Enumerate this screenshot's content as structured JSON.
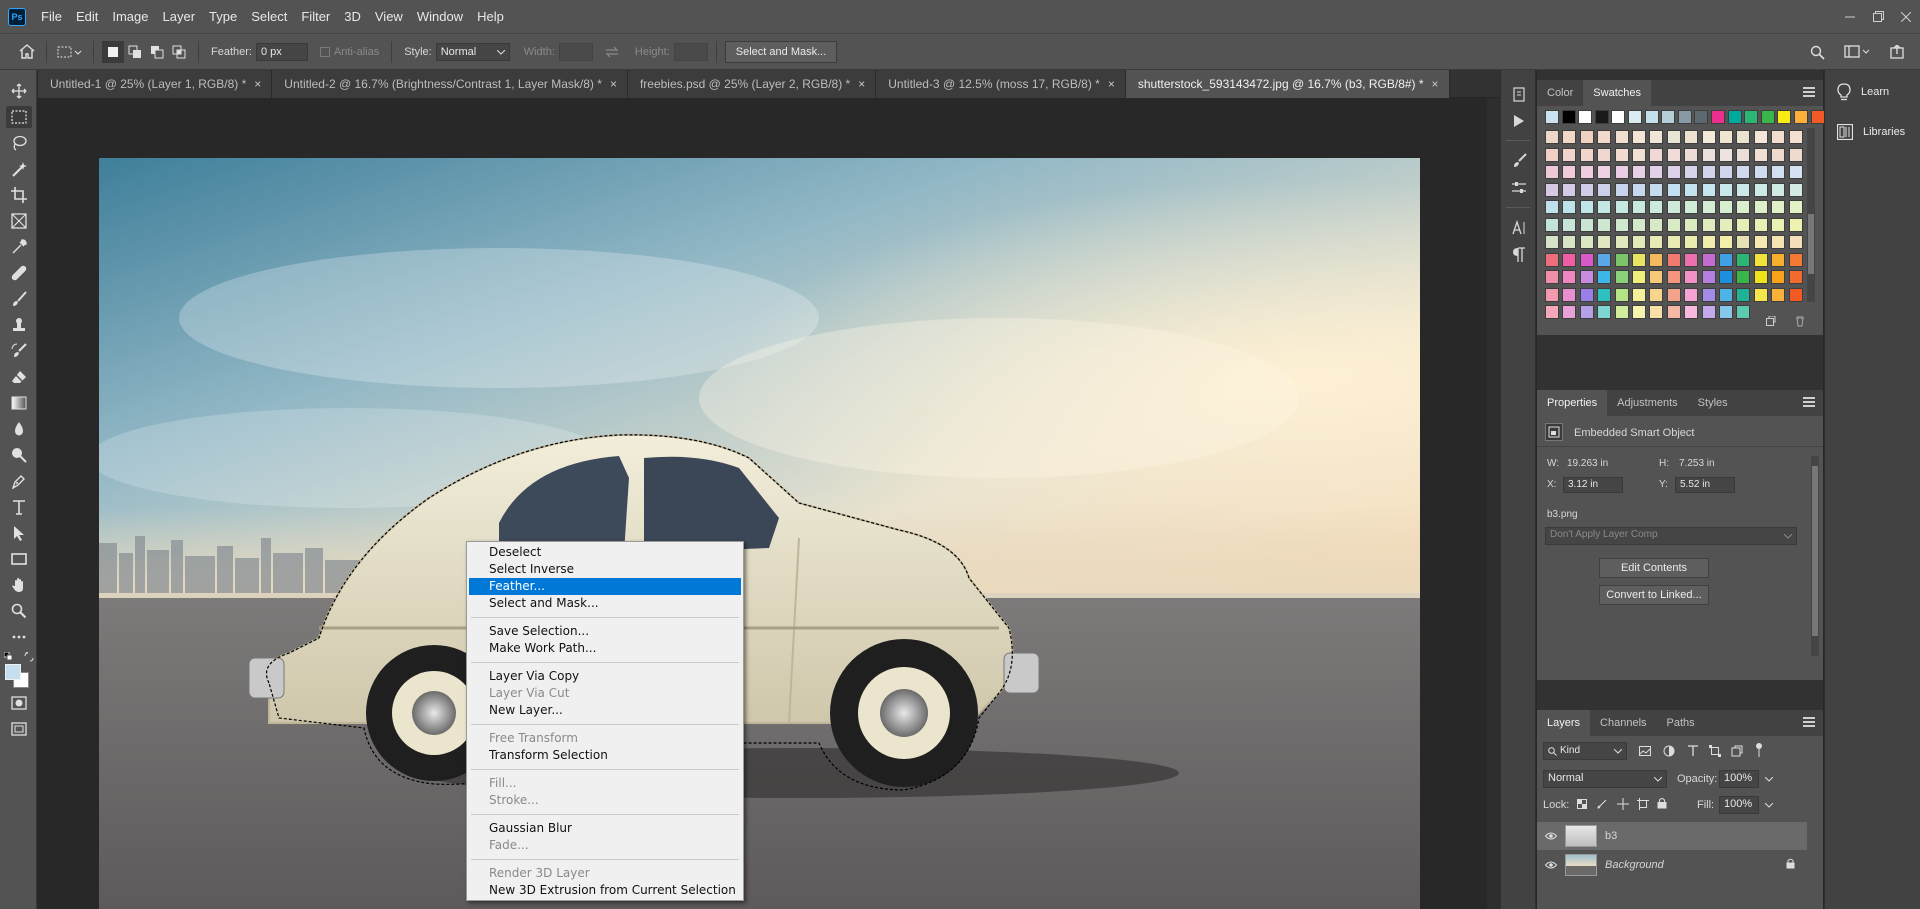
{
  "app": {
    "logo": "Ps"
  },
  "menubar": {
    "items": [
      "File",
      "Edit",
      "Image",
      "Layer",
      "Type",
      "Select",
      "Filter",
      "3D",
      "View",
      "Window",
      "Help"
    ]
  },
  "options": {
    "feather_label": "Feather:",
    "feather_value": "0 px",
    "antialias_label": "Anti-alias",
    "style_label": "Style:",
    "style_value": "Normal",
    "width_label": "Width:",
    "height_label": "Height:",
    "select_mask_label": "Select and Mask..."
  },
  "tabs": [
    {
      "label": "Untitled-1 @ 25% (Layer 1, RGB/8) *",
      "active": false
    },
    {
      "label": "Untitled-2 @ 16.7% (Brightness/Contrast 1, Layer Mask/8) *",
      "active": false
    },
    {
      "label": "freebies.psd @ 25% (Layer 2, RGB/8) *",
      "active": false
    },
    {
      "label": "Untitled-3 @ 12.5% (moss 17, RGB/8) *",
      "active": false
    },
    {
      "label": "shutterstock_593143472.jpg @ 16.7% (b3, RGB/8#) *",
      "active": true
    }
  ],
  "tab_close_glyph": "×",
  "context_menu": {
    "groups": [
      [
        {
          "label": "Deselect",
          "enabled": true
        },
        {
          "label": "Select Inverse",
          "enabled": true
        },
        {
          "label": "Feather...",
          "enabled": true,
          "highlighted": true
        },
        {
          "label": "Select and Mask...",
          "enabled": true
        }
      ],
      [
        {
          "label": "Save Selection...",
          "enabled": true
        },
        {
          "label": "Make Work Path...",
          "enabled": true
        }
      ],
      [
        {
          "label": "Layer Via Copy",
          "enabled": true
        },
        {
          "label": "Layer Via Cut",
          "enabled": false
        },
        {
          "label": "New Layer...",
          "enabled": true
        }
      ],
      [
        {
          "label": "Free Transform",
          "enabled": false
        },
        {
          "label": "Transform Selection",
          "enabled": true
        }
      ],
      [
        {
          "label": "Fill...",
          "enabled": false
        },
        {
          "label": "Stroke...",
          "enabled": false
        }
      ],
      [
        {
          "label": "Gaussian Blur",
          "enabled": true
        },
        {
          "label": "Fade...",
          "enabled": false
        }
      ],
      [
        {
          "label": "Render 3D Layer",
          "enabled": false
        },
        {
          "label": "New 3D Extrusion from Current Selection",
          "enabled": true
        }
      ]
    ]
  },
  "swatches_panel": {
    "tabs": [
      "Color",
      "Swatches"
    ],
    "active_tab": "Swatches",
    "top_row": [
      "#c9e3ef",
      "#000000",
      "#ffffff",
      "#1a1a1a",
      "#ffffff",
      "#d8ecf2",
      "#c5e2ec",
      "#b5cfd9",
      "#8a9aa5",
      "#5c6970",
      "#ec2e8f",
      "#00a99d",
      "#2bb673",
      "#39b54a",
      "#f7ec13",
      "#fbb03b",
      "#f15a24"
    ],
    "grid_rows": [
      [
        "#efd6c8",
        "#f0d8c5",
        "#efd2c1",
        "#f2d9cb",
        "#f0dfcf",
        "#f3e6d6",
        "#f0e6d8",
        "#e9e5d5",
        "#ece2cf",
        "#f3ead8",
        "#f0e7d2",
        "#eae3cf",
        "#f4e6d8",
        "#f1dccf",
        "#f4e0d1"
      ],
      [
        "#f1d0c6",
        "#f1d3ca",
        "#f1d5cd",
        "#f0d7cf",
        "#f2dbd0",
        "#f2e0d5",
        "#efd8d5",
        "#f1dcd8",
        "#eedcd8",
        "#ece1db",
        "#efe3df",
        "#ebddd7",
        "#f0e0d4",
        "#eedbd0",
        "#f0d9ce"
      ],
      [
        "#efc8d8",
        "#f1cadc",
        "#efcce0",
        "#eed2e4",
        "#e9cde4",
        "#e6d0e8",
        "#e3d1ea",
        "#dcd0ea",
        "#d8d2ea",
        "#d2d4ec",
        "#d0d6ee",
        "#cfd8ee",
        "#cfdcef",
        "#d2dff0",
        "#d6e2f2"
      ],
      [
        "#d7c9e3",
        "#d4cbe6",
        "#d0cce8",
        "#cdd0ea",
        "#c9d4ec",
        "#c6d8ee",
        "#c5dcef",
        "#c3e0f0",
        "#c2e3ef",
        "#c5e6ee",
        "#c8e8ec",
        "#cbe9ea",
        "#cdeae7",
        "#d0eae4",
        "#d4ebe1"
      ],
      [
        "#bee1ec",
        "#bde3ea",
        "#bfe5e8",
        "#c2e7e5",
        "#c5e8e2",
        "#c8e9df",
        "#cbeadc",
        "#ceebd9",
        "#d1ecd6",
        "#d4edd3",
        "#d7eed0",
        "#daefcd",
        "#ddf0ca",
        "#e0f1c7",
        "#e3f2c4"
      ],
      [
        "#c4e3d8",
        "#c7e5d6",
        "#cae6d3",
        "#cde7d0",
        "#d0e8cd",
        "#d3e9ca",
        "#d6eac7",
        "#d9ebc4",
        "#dcecc1",
        "#dfedbe",
        "#e2eebb",
        "#e5efb8",
        "#e8f0b5",
        "#ebf1b2",
        "#eef2af"
      ],
      [
        "#d5e4c8",
        "#d8e5c5",
        "#dbe6c2",
        "#dee7bf",
        "#e1e8bc",
        "#e4e9b9",
        "#e7eab6",
        "#eaebb3",
        "#edecb0",
        "#f0edad",
        "#f3eeaa",
        "#e6e0b5",
        "#f5e8b0",
        "#f6e3b3",
        "#f4dfb8"
      ],
      [
        "#ee6f7b",
        "#ef5da3",
        "#d75ac8",
        "#5aa8e8",
        "#7ac46a",
        "#e8e461",
        "#f4b85f",
        "#f07a70",
        "#ec6fb0",
        "#c46bd2",
        "#3fa0e3",
        "#2bb673",
        "#f2e23c",
        "#f7b02e",
        "#f47a33"
      ],
      [
        "#f08fa8",
        "#ee86c1",
        "#c98be0",
        "#3db7e8",
        "#88d27a",
        "#f0ef79",
        "#f7c978",
        "#f6957f",
        "#f390c7",
        "#b47fe0",
        "#1e90e0",
        "#39b54a",
        "#ece31a",
        "#f9a31b",
        "#f26a2e"
      ],
      [
        "#f39ab0",
        "#e88fd0",
        "#9b7fe8",
        "#2cc0c0",
        "#b5e486",
        "#f5f19a",
        "#f7d58f",
        "#f3a28b",
        "#f5a3d4",
        "#a58be8",
        "#4fb3e8",
        "#1db394",
        "#f5e64d",
        "#fbb03b",
        "#f15a24"
      ],
      [
        "#f6a8bb",
        "#e8a0d8",
        "#b6a0ec",
        "#7ed6d0",
        "#d0ec9c",
        "#f7f4b0",
        "#f9e0a8",
        "#f6b7a4",
        "#f7b9dd",
        "#c4a9ee",
        "#86c8ec",
        "#5cc9b0",
        "",
        "",
        ""
      ]
    ]
  },
  "properties_panel": {
    "tabs": [
      "Properties",
      "Adjustments",
      "Styles"
    ],
    "active_tab": "Properties",
    "type_label": "Embedded Smart Object",
    "w_label": "W:",
    "w_value": "19.263 in",
    "h_label": "H:",
    "h_value": "7.253 in",
    "x_label": "X:",
    "x_value": "3.12 in",
    "y_label": "Y:",
    "y_value": "5.52 in",
    "filename": "b3.png",
    "layer_comp": "Don't Apply Layer Comp",
    "edit_contents": "Edit Contents",
    "convert_linked": "Convert to Linked..."
  },
  "layers_panel": {
    "tabs": [
      "Layers",
      "Channels",
      "Paths"
    ],
    "active_tab": "Layers",
    "filter_kind": "Kind",
    "blend_mode": "Normal",
    "opacity_label": "Opacity:",
    "opacity_value": "100%",
    "lock_label": "Lock:",
    "fill_label": "Fill:",
    "fill_value": "100%",
    "layers": [
      {
        "name": "b3",
        "selected": true,
        "locked": false
      },
      {
        "name": "Background",
        "selected": false,
        "locked": true
      }
    ]
  },
  "learn_libraries": {
    "learn": "Learn",
    "libraries": "Libraries"
  }
}
